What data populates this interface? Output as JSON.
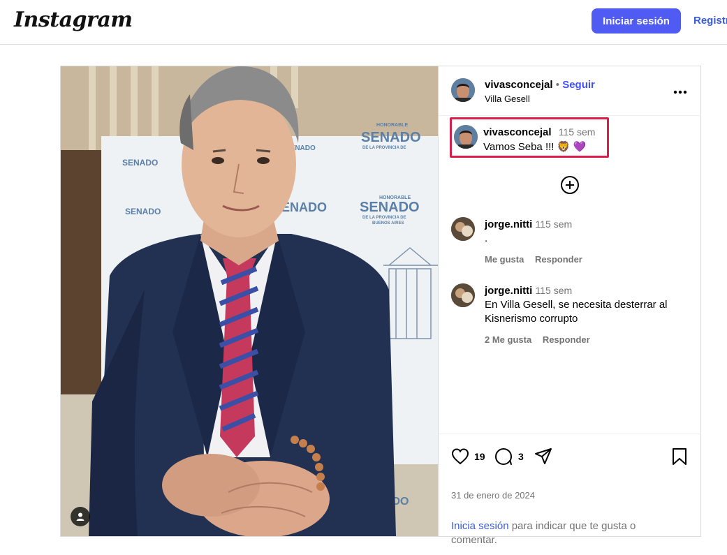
{
  "header": {
    "logo": "Instagram",
    "login_button": "Iniciar sesión",
    "signup_link": "Registr"
  },
  "post": {
    "author": {
      "username": "vivasconcejal",
      "separator": "•",
      "follow": "Seguir",
      "location": "Villa Gesell"
    },
    "media_wall_text": {
      "honorable": "HONORABLE",
      "senado": "SENADO",
      "province_line1": "DE LA PROVINCIA DE",
      "province_line2": "BUENOS AIRES"
    },
    "caption": {
      "username": "vivasconcejal",
      "time": "115 sem",
      "text": "Vamos Seba !!! 🦁 💜"
    },
    "comments": [
      {
        "username": "jorge.nitti",
        "time": "115 sem",
        "text": ".",
        "likes": "Me gusta",
        "reply": "Responder"
      },
      {
        "username": "jorge.nitti",
        "time": "115 sem",
        "text": "En Villa Gesell, se necesita desterrar al Kisnerismo corrupto",
        "likes": "2 Me gusta",
        "reply": "Responder"
      }
    ],
    "stats": {
      "likes": "19",
      "comments": "3"
    },
    "date": "31 de enero de 2024",
    "login_prompt": {
      "link": "Inicia sesión",
      "rest": " para indicar que te gusta o comentar."
    }
  },
  "colors": {
    "primary_button": "#4f5bf2",
    "link_blue": "#4150f7",
    "highlight_box": "#d81f4a"
  },
  "icons": [
    "user-icon",
    "more-icon",
    "plus-circle-icon",
    "heart-icon",
    "comment-icon",
    "share-icon",
    "bookmark-icon"
  ]
}
